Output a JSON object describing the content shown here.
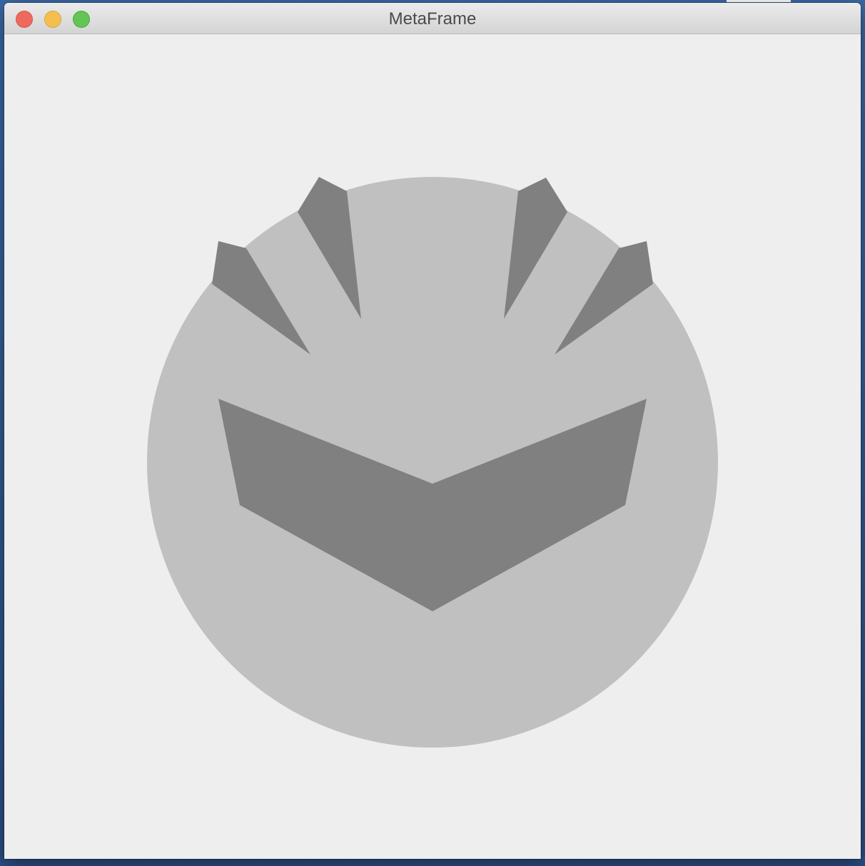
{
  "window": {
    "title": "MetaFrame",
    "controls": {
      "close_icon": "close-icon",
      "minimize_icon": "minimize-icon",
      "zoom_icon": "zoom-icon"
    }
  },
  "colors": {
    "desktop": "#2f5b93",
    "window_background": "#eeeeee",
    "close": "#ee6a5f",
    "close_border": "#d9534a",
    "minimize": "#f5bf4f",
    "minimize_border": "#d9a43c",
    "zoom": "#62c554",
    "zoom_border": "#4ea843",
    "face": "#c0c0c0",
    "mask": "#808080"
  },
  "canvas": {
    "drawing": "mask-face-icon"
  }
}
